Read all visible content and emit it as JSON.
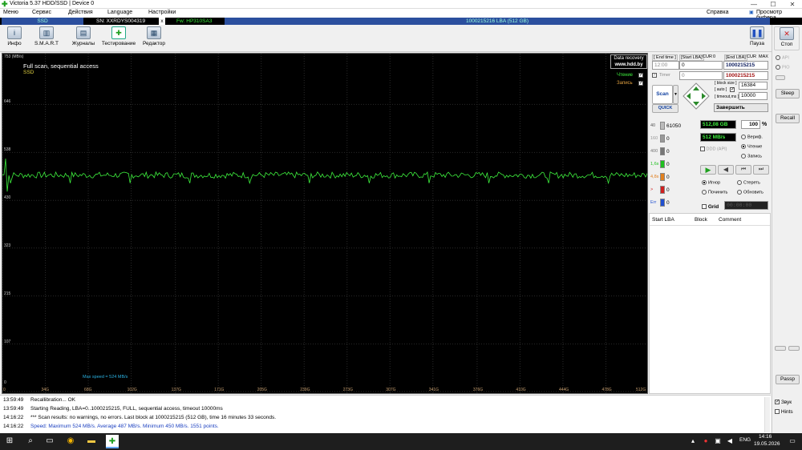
{
  "window": {
    "title": "Victoria 5.37 HDD/SSD | Device 0",
    "min": "—",
    "max": "☐",
    "close": "✕"
  },
  "menu": {
    "items": [
      "Меню",
      "Сервис",
      "Действия",
      "Language",
      "Настройки"
    ],
    "right": [
      "Справка",
      "Просмотр буфера"
    ]
  },
  "infobar": {
    "model": "SSD",
    "sn": "SN: XXRDYS004319",
    "close": "x",
    "fw": "Fw: HP310SA3",
    "lba": "1000215216 LBA (512 GB)"
  },
  "toolbar": {
    "buttons": [
      "Инфо",
      "S.M.A.R.T",
      "Журналы",
      "Тестирование",
      "Редактор"
    ],
    "pause": "Пауза",
    "stop": "Стоп"
  },
  "graph": {
    "title": "Full scan, sequential access",
    "subtitle": "SSD",
    "y_unit": "753 (MB/s)",
    "recovery": [
      "Data recovery",
      "www.hdd.by"
    ],
    "legend": [
      {
        "name": "Чтение",
        "color": "#3ef03e"
      },
      {
        "name": "Запись",
        "color": "#e0a040"
      }
    ],
    "maxspeed": "Max speed = 524 MB/s"
  },
  "chart_data": {
    "type": "line",
    "y_ticks": [
      "646",
      "538",
      "430",
      "323",
      "215",
      "107",
      "0"
    ],
    "x_ticks": [
      "0",
      "34G",
      "68G",
      "102G",
      "137G",
      "171G",
      "205G",
      "239G",
      "273G",
      "307G",
      "341G",
      "376G",
      "410G",
      "444G",
      "478G",
      "512G"
    ],
    "ylim": [
      0,
      753
    ],
    "xlim": [
      0,
      512
    ],
    "series": [
      {
        "name": "Чтение",
        "color": "#3ef03e",
        "mean": 487,
        "min": 450,
        "max": 524
      }
    ]
  },
  "controls": {
    "end_time_lbl": "[ End time ]",
    "start_lba_lbl": "[Start LBA]",
    "cur_lbl": "CUR",
    "cur_val": "0",
    "end_lba_lbl": "[End LBA]",
    "cur2_lbl": "CUR",
    "max_lbl": "MAX",
    "time_val": "12:00",
    "start_lba": "0",
    "end_lba": "1000215215",
    "timer_lbl": "Timer",
    "timer_val": "0",
    "end_lba2": "1000215215",
    "block_size_lbl": "[ block size ]",
    "auto_lbl": "[ auto ]",
    "timeout_lbl": "[ timeout,ms ]",
    "block_size": "16384",
    "timeout": "10000",
    "scan": "Scan",
    "quick": "QUICK",
    "finish": "Завершить",
    "counts": [
      {
        "label": "40",
        "val": "61050",
        "color": "#bbbbbb"
      },
      {
        "label": "160",
        "val": "0",
        "color": "#999999"
      },
      {
        "label": "400",
        "val": "0",
        "color": "#777777"
      },
      {
        "label": "1,6s",
        "val": "0",
        "color": "#20c020"
      },
      {
        "label": "4,8s",
        "val": "0",
        "color": "#e08020"
      },
      {
        "label": ">",
        "val": "0",
        "color": "#d02020"
      },
      {
        "label": "Err",
        "val": "0",
        "color": "#2050d0"
      }
    ],
    "done_size": "512,08 GB",
    "percent": "100",
    "pct_sign": "%",
    "speed": "512 MB/s",
    "ddd": "DDD (API)",
    "verify": "Вериф.",
    "read": "Чтение",
    "write": "Запись",
    "ignore": "Игнор",
    "erase": "Стереть",
    "repair": "Починить",
    "update": "Обновить",
    "grid": "Grid",
    "clock": "00:00:00",
    "table_cols": [
      "Start LBA",
      "Block",
      "Comment"
    ]
  },
  "farright": {
    "api": "API",
    "pio": "PIO",
    "sleep": "Sleep",
    "recall": "Recall",
    "passp": "Passp",
    "sound": "Звук",
    "hints": "Hints"
  },
  "log": [
    {
      "time": "13:59:49",
      "text": "Recallibration... OK",
      "color": "#000000"
    },
    {
      "time": "13:59:49",
      "text": "Starting Reading, LBA=0..1000215215, FULL, sequential access, timeout 10000ms",
      "color": "#000000"
    },
    {
      "time": "14:16:22",
      "text": "*** Scan results: no warnings, no errors. Last block at 1000215215 (512 GB), time 16 minutes 33 seconds.",
      "color": "#000000"
    },
    {
      "time": "14:16:22",
      "text": "Speed: Maximum 524 MB/s. Average 487 MB/s. Minimum 450 MB/s. 1551 points.",
      "color": "#1a3fc0"
    }
  ],
  "taskbar": {
    "lang": "ENG",
    "time": "14:16",
    "date": "19.05.2026"
  }
}
